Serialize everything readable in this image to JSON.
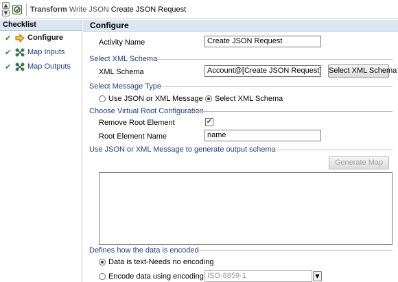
{
  "titlebar": {
    "type": "Transform",
    "subtitle": "Write JSON",
    "name": "Create  JSON Request",
    "icon": "transform-icon"
  },
  "checklist": {
    "title": "Checklist",
    "items": [
      {
        "label": "Configure",
        "icon": "arrow-right-icon",
        "active": true
      },
      {
        "label": "Map Inputs",
        "icon": "map-icon",
        "active": false
      },
      {
        "label": "Map Outputs",
        "icon": "map-icon",
        "active": false
      }
    ]
  },
  "configure": {
    "title": "Configure",
    "activity_name_label": "Activity Name",
    "activity_name_value": "Create  JSON Request",
    "schema_section": "Select XML Schema",
    "xml_schema_label": "XML Schema",
    "xml_schema_value": "Account@[Create  JSON Request]/{name}",
    "select_schema_button": "Select XML Schema",
    "message_type_section": "Select Message Type",
    "radio_json_label": "Use JSON or XML Message",
    "radio_schema_label": "Select XML Schema",
    "selected_message_type": "Select XML Schema",
    "virtual_root_section": "Choose Virtual Root Configuration",
    "remove_root_label": "Remove Root Element",
    "remove_root_checked": true,
    "root_name_label": "Root Element Name",
    "root_name_value": "name",
    "generate_section": "Use JSON or XML Message to generate output schema",
    "generate_button": "Generate Map",
    "encoding_section": "Defines how the data is encoded",
    "radio_text_label": "Data is text-Needs no encoding",
    "radio_encode_label": "Encode data using encoding type:",
    "selected_encoding_mode": "Data is text-Needs no encoding",
    "encoding_value": "ISO-8859-1"
  },
  "colors": {
    "header_bg": "#dbe6f3",
    "section_text": "#1f3d7a",
    "check_green": "#2a8a2a"
  }
}
